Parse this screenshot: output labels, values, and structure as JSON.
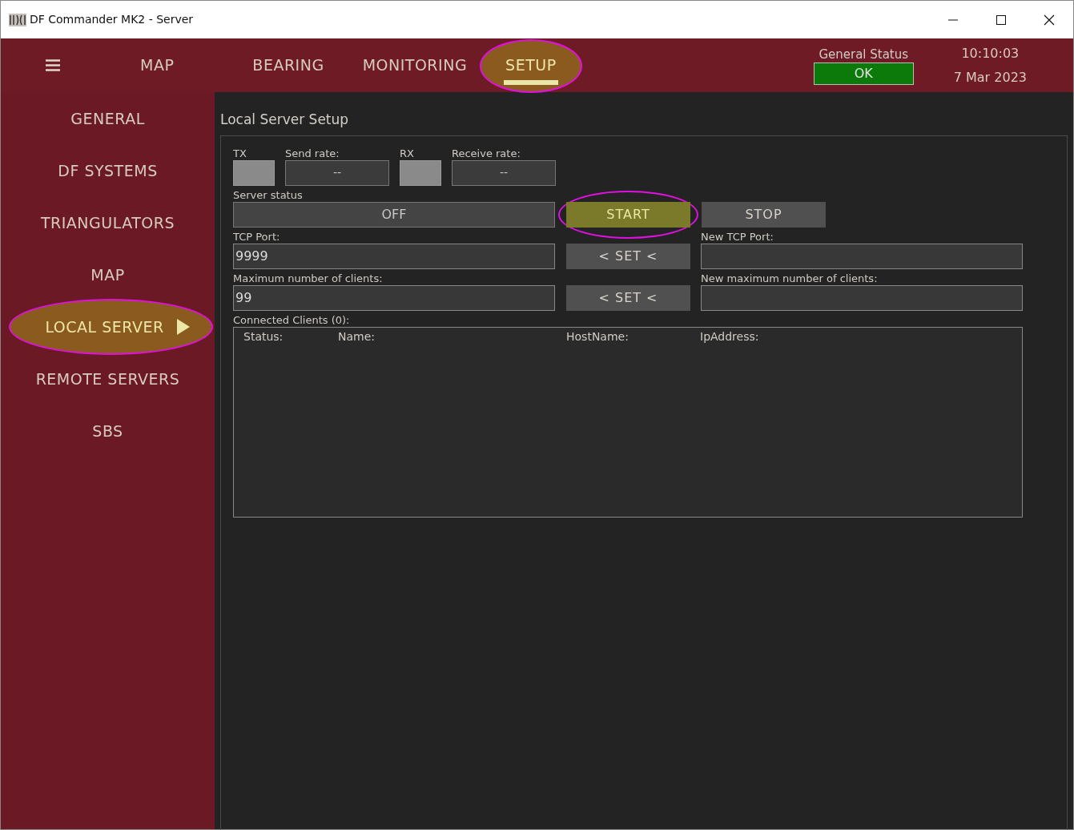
{
  "window": {
    "title": "DF Commander MK2 - Server"
  },
  "header": {
    "tabs": [
      {
        "label": "MAP",
        "selected": false,
        "highlighted": false
      },
      {
        "label": "BEARING",
        "selected": false,
        "highlighted": false
      },
      {
        "label": "MONITORING",
        "selected": false,
        "highlighted": false
      },
      {
        "label": "SETUP",
        "selected": true,
        "highlighted": true
      }
    ],
    "general_status": {
      "label": "General Status",
      "value": "OK"
    },
    "time": "10:10:03",
    "date": "7 Mar 2023"
  },
  "sidebar": {
    "items": [
      {
        "label": "GENERAL",
        "selected": false,
        "highlighted": false
      },
      {
        "label": "DF SYSTEMS",
        "selected": false,
        "highlighted": false
      },
      {
        "label": "TRIANGULATORS",
        "selected": false,
        "highlighted": false
      },
      {
        "label": "MAP",
        "selected": false,
        "highlighted": false
      },
      {
        "label": "LOCAL SERVER",
        "selected": true,
        "highlighted": true
      },
      {
        "label": "REMOTE SERVERS",
        "selected": false,
        "highlighted": false
      },
      {
        "label": "SBS",
        "selected": false,
        "highlighted": false
      }
    ]
  },
  "section_title": "Local Server Setup",
  "rates": {
    "tx_label": "TX",
    "send_rate_label": "Send rate:",
    "send_rate": "--",
    "rx_label": "RX",
    "receive_rate_label": "Receive rate:",
    "receive_rate": "--"
  },
  "server_status": {
    "label": "Server status",
    "value": "OFF"
  },
  "buttons": [
    {
      "label": "START",
      "highlighted": true
    },
    {
      "label": "STOP",
      "highlighted": false
    }
  ],
  "settings": [
    {
      "label": "TCP Port:",
      "value": "9999",
      "set_button": "< SET <",
      "new_label": "New TCP Port:"
    },
    {
      "label": "Maximum number of clients:",
      "value": "99",
      "set_button": "< SET <",
      "new_label": "New maximum number of clients:"
    }
  ],
  "clients": {
    "label": "Connected Clients (0):",
    "columns": [
      "Status:",
      "Name:",
      "HostName:",
      "IpAddress:"
    ]
  }
}
